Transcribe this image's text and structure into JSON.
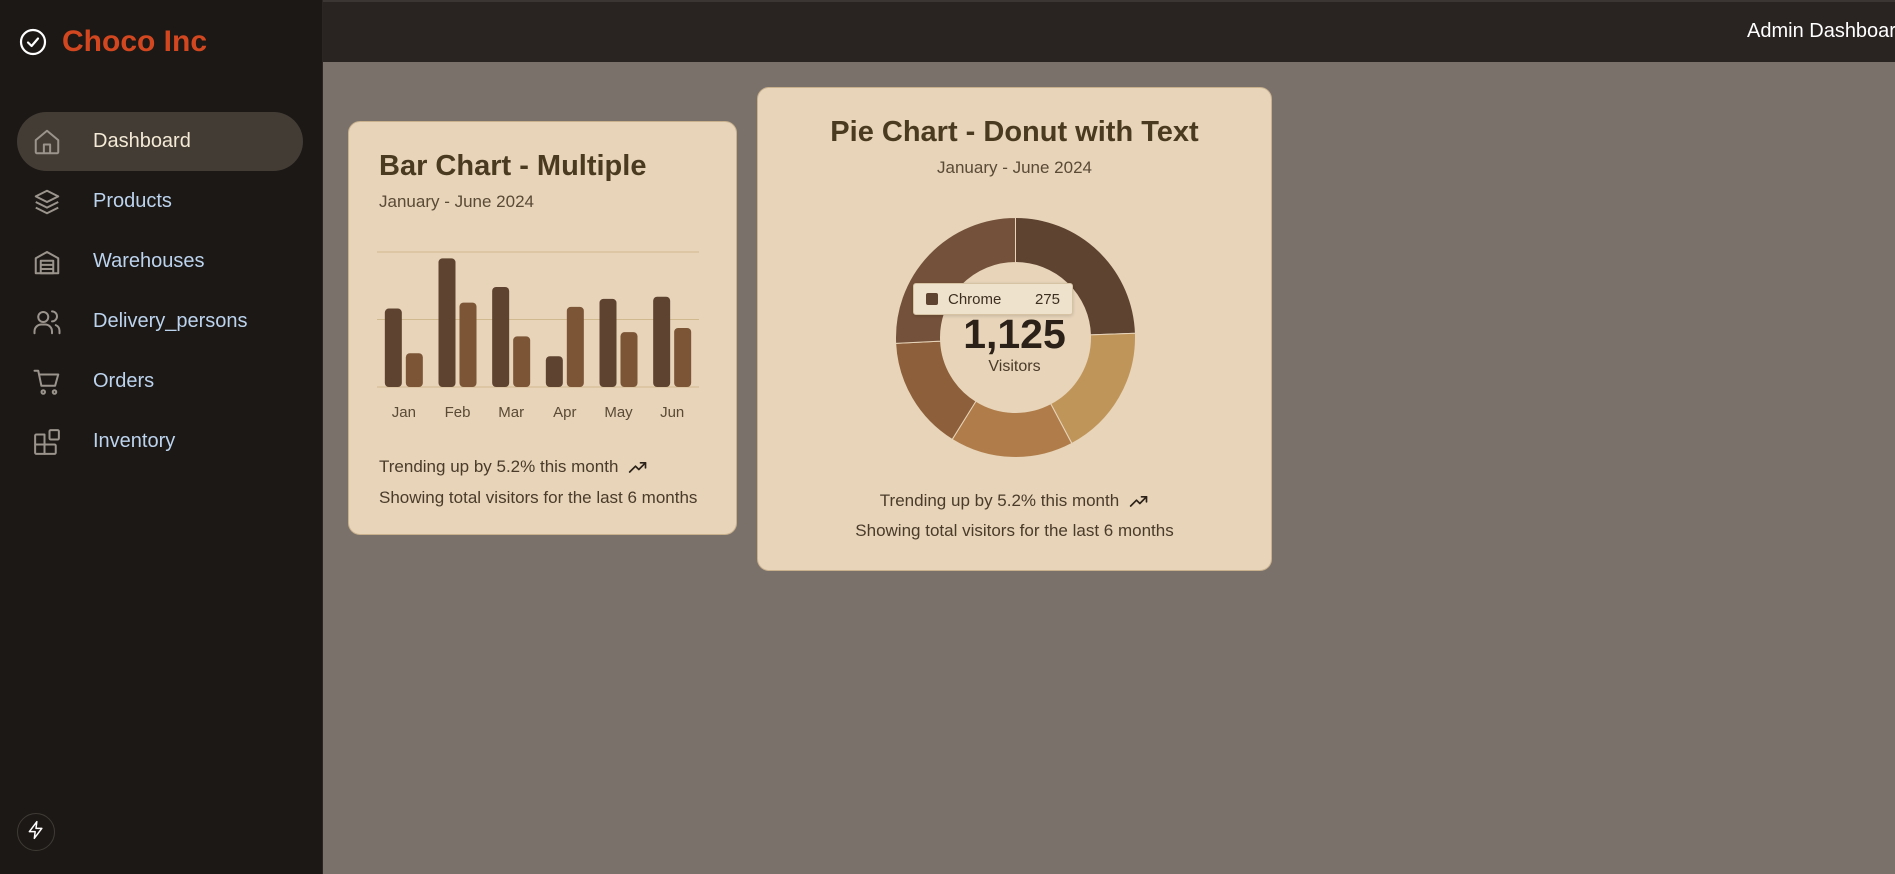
{
  "brand": {
    "name": "Choco Inc",
    "icon": "check-circle-icon",
    "color": "#d2471f"
  },
  "header": {
    "title": "Admin Dashboard"
  },
  "sidebar": {
    "items": [
      {
        "label": "Dashboard",
        "icon": "home-icon",
        "active": true
      },
      {
        "label": "Products",
        "icon": "layers-icon",
        "active": false
      },
      {
        "label": "Warehouses",
        "icon": "warehouse-icon",
        "active": false
      },
      {
        "label": "Delivery_persons",
        "icon": "users-icon",
        "active": false
      },
      {
        "label": "Orders",
        "icon": "cart-icon",
        "active": false
      },
      {
        "label": "Inventory",
        "icon": "blocks-icon",
        "active": false
      }
    ],
    "bottom_icon": "bolt-icon"
  },
  "bar_card": {
    "title": "Bar Chart - Multiple",
    "subtitle": "January - June 2024",
    "trend_text": "Trending up by 5.2% this month",
    "description": "Showing total visitors for the last 6 months"
  },
  "pie_card": {
    "title": "Pie Chart - Donut with Text",
    "subtitle": "January - June 2024",
    "total": "1,125",
    "total_label": "Visitors",
    "tooltip": {
      "name": "Chrome",
      "value": "275"
    },
    "trend_text": "Trending up by 5.2% this month",
    "description": "Showing total visitors for the last 6 months"
  },
  "chart_data": [
    {
      "type": "bar",
      "categories": [
        "Jan",
        "Feb",
        "Mar",
        "Apr",
        "May",
        "Jun"
      ],
      "series": [
        {
          "values": [
            186,
            305,
            237,
            73,
            209,
            214
          ],
          "color": "#5e4330"
        },
        {
          "values": [
            80,
            200,
            120,
            190,
            130,
            140
          ],
          "color": "#7b5536"
        }
      ],
      "ylim": [
        0,
        320
      ],
      "grid": true
    },
    {
      "type": "pie",
      "donut": true,
      "slices": [
        {
          "name": "Chrome",
          "value": 275,
          "color": "#5e4330"
        },
        {
          "value": 200,
          "color": "#c0955a"
        },
        {
          "value": 187,
          "color": "#b07d4a"
        },
        {
          "value": 173,
          "color": "#8d5f3a"
        },
        {
          "value": 290,
          "color": "#74513a"
        }
      ]
    }
  ]
}
